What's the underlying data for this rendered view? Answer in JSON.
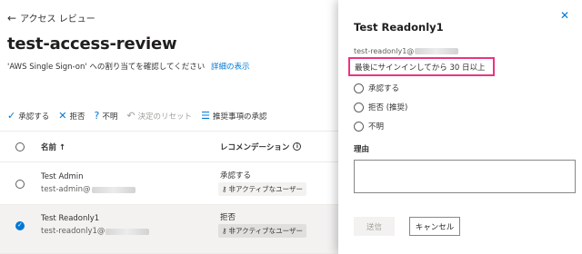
{
  "main": {
    "back_label": "アクセス レビュー",
    "title": "test-access-review",
    "description": "'AWS Single Sign-on' への割り当てを確認してください",
    "details_link": "詳細の表示",
    "toolbar": {
      "approve": "承認する",
      "deny": "拒否",
      "dont_know": "不明",
      "reset": "決定のリセット",
      "accept_recommendations": "推奨事項の承認"
    },
    "table": {
      "col_name": "名前 ↑",
      "col_recommendation": "レコメンデーション",
      "rows": [
        {
          "name": "Test Admin",
          "email_prefix": "test-admin@",
          "recommendation": "承認する",
          "tag": "非アクティブなユーザー",
          "selected": false
        },
        {
          "name": "Test Readonly1",
          "email_prefix": "test-readonly1@",
          "recommendation": "拒否",
          "tag": "非アクティブなユーザー",
          "selected": true
        }
      ]
    }
  },
  "panel": {
    "title": "Test Readonly1",
    "email_prefix": "test-readonly1@",
    "last_signin": "最後にサインインしてから 30 日以上",
    "options": [
      "承認する",
      "拒否 (推奨)",
      "不明"
    ],
    "reason_label": "理由",
    "submit_label": "送信",
    "cancel_label": "キャンセル"
  },
  "colors": {
    "accent": "#0078d4",
    "highlight": "#e8367f"
  }
}
